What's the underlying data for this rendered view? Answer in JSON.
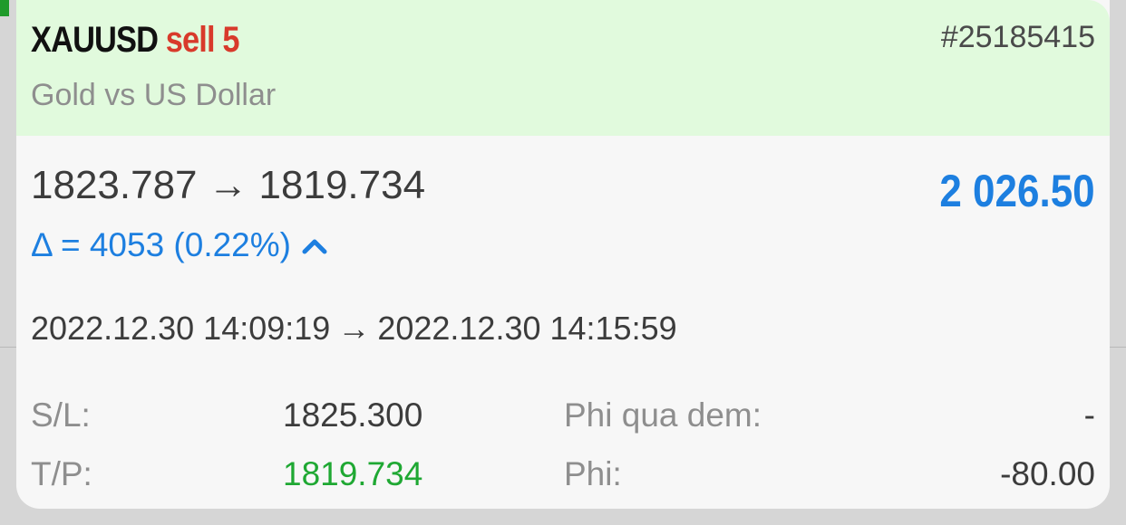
{
  "position": {
    "symbol": "XAUUSD",
    "side_label": "sell 5",
    "ticket": "#25185415",
    "description": "Gold vs US Dollar",
    "open_price": "1823.787",
    "close_price": "1819.734",
    "price_arrow": "→",
    "profit": "2 026.50",
    "delta_text": "Δ = 4053 (0.22%)",
    "open_time": "2022.12.30 14:09:19",
    "close_time": "2022.12.30 14:15:59",
    "time_arrow": "→"
  },
  "details": {
    "sl_label": "S/L:",
    "sl_value": "1825.300",
    "tp_label": "T/P:",
    "tp_value": "1819.734",
    "swap_label": "Phi qua dem:",
    "swap_value": "-",
    "commission_label": "Phi:",
    "commission_value": "-80.00"
  },
  "colors": {
    "header_bg": "#e1fadd",
    "sell": "#d83a2b",
    "profit_blue": "#1d7fe0",
    "tp_green": "#1fa833",
    "muted": "#8e8e8e"
  },
  "icons": {
    "delta_direction": "chevron-up-icon"
  }
}
